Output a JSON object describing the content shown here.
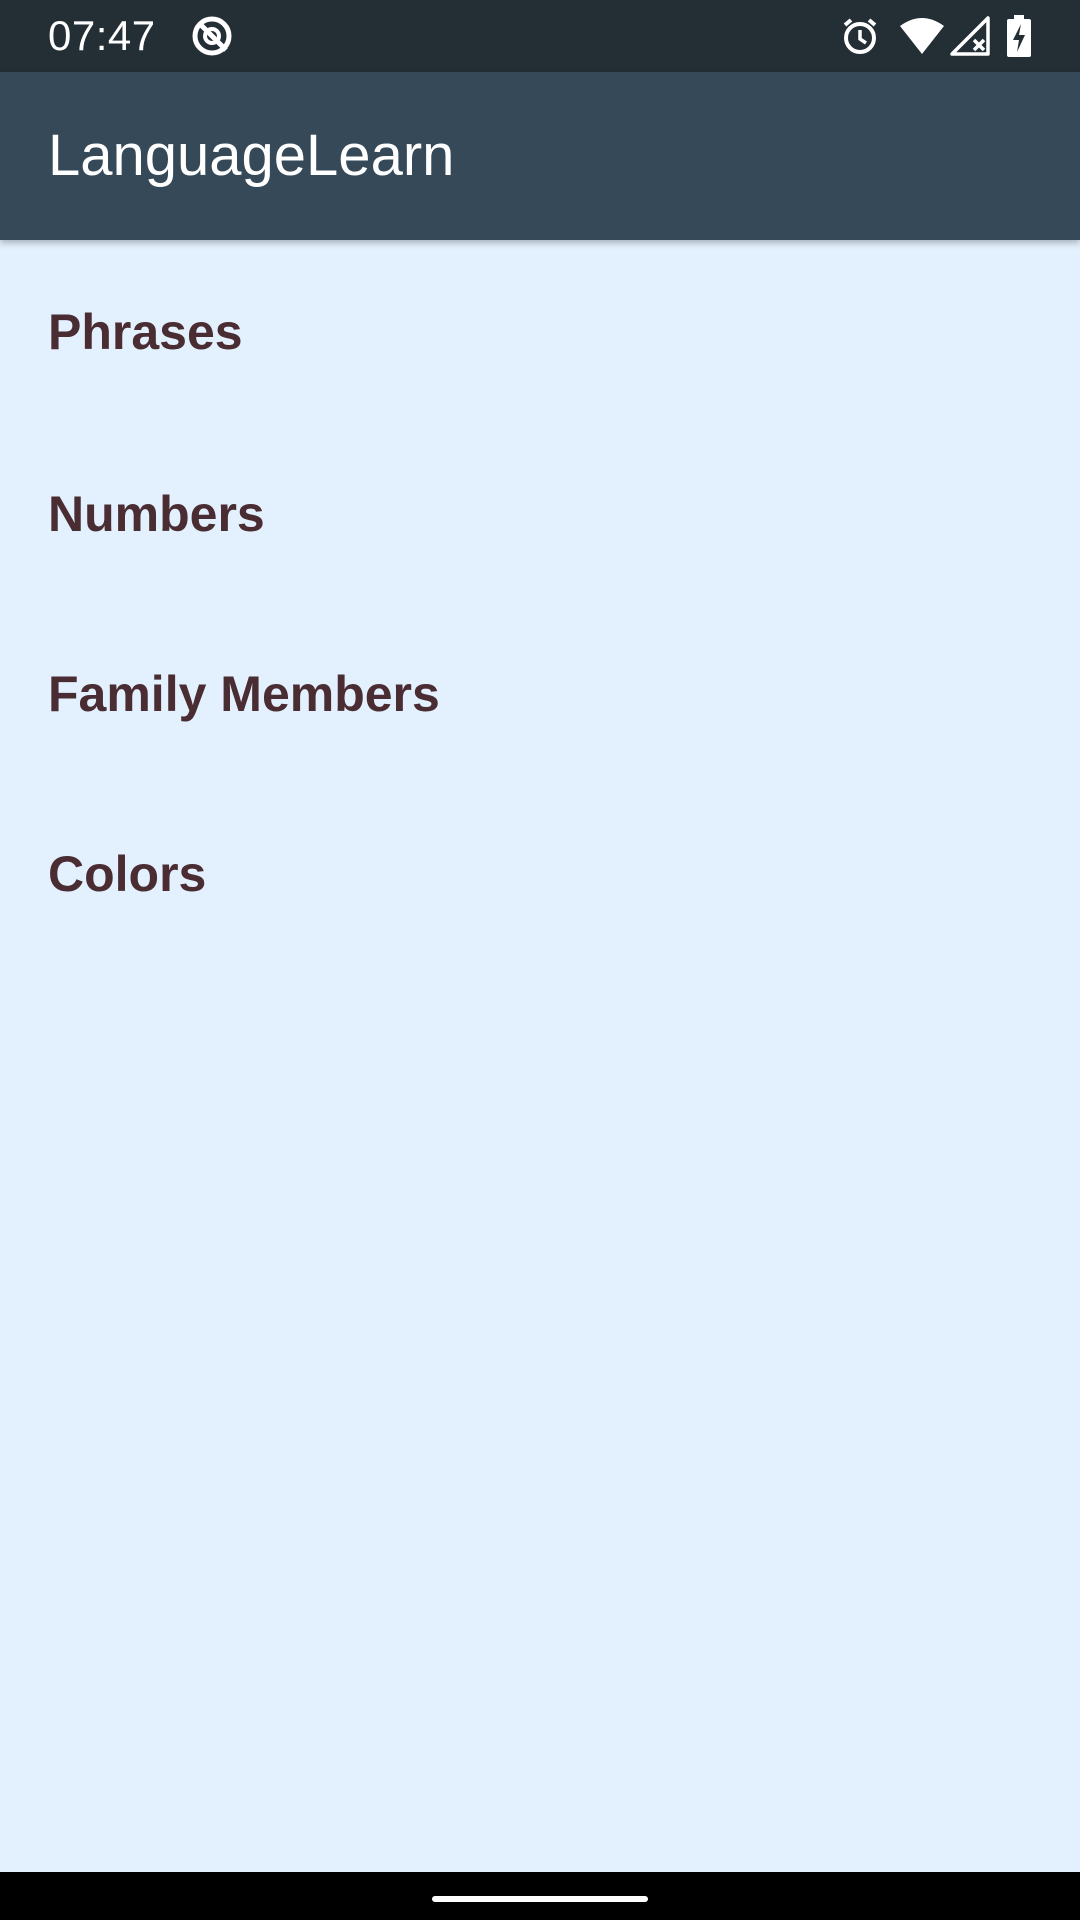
{
  "status_bar": {
    "time": "07:47",
    "icons": [
      "sync-disabled-icon",
      "alarm-icon",
      "wifi-icon",
      "cellular-no-signal-icon",
      "battery-charging-icon"
    ]
  },
  "app_bar": {
    "title": "LanguageLearn"
  },
  "categories": [
    {
      "label": "Phrases"
    },
    {
      "label": "Numbers"
    },
    {
      "label": "Family Members"
    },
    {
      "label": "Colors"
    }
  ],
  "colors": {
    "status_bar": "#232e35",
    "app_bar": "#364958",
    "background": "#e3f0fd",
    "category_text": "#4a2c33"
  }
}
